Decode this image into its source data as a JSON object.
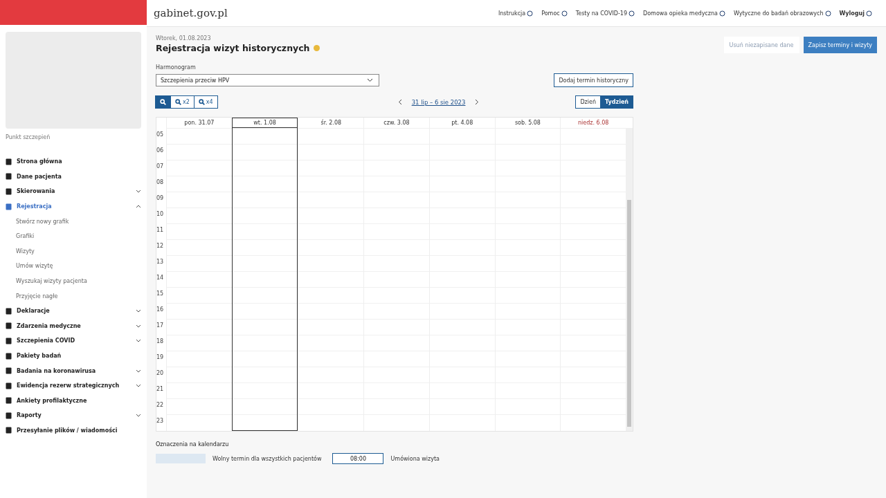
{
  "header": {
    "site_title": "gabinet.gov.pl",
    "links": [
      {
        "label": "Instrukcja",
        "bold": false
      },
      {
        "label": "Pomoc",
        "bold": false
      },
      {
        "label": "Testy na COVID-19",
        "bold": false
      },
      {
        "label": "Domowa opieka medyczna",
        "bold": false
      },
      {
        "label": "Wytyczne do badań obrazowych",
        "bold": false
      },
      {
        "label": "Wyloguj",
        "bold": true
      }
    ]
  },
  "sidebar": {
    "place_label": "Punkt szczepień",
    "items": [
      {
        "label": "Strona główna",
        "kind": "link",
        "selected": false
      },
      {
        "label": "Dane pacjenta",
        "kind": "link",
        "selected": false
      },
      {
        "label": "Skierowania",
        "kind": "group",
        "selected": false,
        "expanded": false
      },
      {
        "label": "Rejestracja",
        "kind": "group",
        "selected": true,
        "expanded": true,
        "children": [
          {
            "label": "Stwórz nowy grafik"
          },
          {
            "label": "Grafiki"
          },
          {
            "label": "Wizyty"
          },
          {
            "label": "Umów wizytę"
          },
          {
            "label": "Wyszukaj wizyty pacjenta"
          },
          {
            "label": "Przyjęcie nagłe"
          }
        ]
      },
      {
        "label": "Deklaracje",
        "kind": "group",
        "selected": false,
        "expanded": false
      },
      {
        "label": "Zdarzenia medyczne",
        "kind": "group",
        "selected": false,
        "expanded": false
      },
      {
        "label": "Szczepienia COVID",
        "kind": "group",
        "selected": false,
        "expanded": false
      },
      {
        "label": "Pakiety badań",
        "kind": "link",
        "selected": false
      },
      {
        "label": "Badania na koronawirusa",
        "kind": "group",
        "selected": false,
        "expanded": false
      },
      {
        "label": "Ewidencja rezerw strategicznych",
        "kind": "group",
        "selected": false,
        "expanded": false
      },
      {
        "label": "Ankiety profilaktyczne",
        "kind": "link",
        "selected": false
      },
      {
        "label": "Raporty",
        "kind": "group",
        "selected": false,
        "expanded": false
      },
      {
        "label": "Przesyłanie plików / wiadomości",
        "kind": "link",
        "selected": false
      }
    ]
  },
  "page": {
    "date": "Wtorek, 01.08.2023",
    "title": "Rejestracja wizyt historycznych",
    "actions": {
      "clear": "Usuń niezapisane dane",
      "save": "Zapisz terminy i wizyty"
    },
    "schedule": {
      "label": "Harmonogram",
      "value": "Szczepienia przeciw HPV"
    },
    "add_button": "Dodaj termin historyczny",
    "zoom": [
      {
        "selected": true
      },
      {
        "label": "x2",
        "selected": false
      },
      {
        "label": "x4",
        "selected": false
      }
    ],
    "range": "31 lip – 6 sie 2023",
    "views": [
      {
        "label": "Dzień",
        "selected": false
      },
      {
        "label": "Tydzień",
        "selected": true
      }
    ]
  },
  "calendar": {
    "days": [
      {
        "label": "pon. 31.07",
        "selected": false,
        "holiday": false
      },
      {
        "label": "wt. 1.08",
        "selected": true,
        "holiday": false
      },
      {
        "label": "śr. 2.08",
        "selected": false,
        "holiday": false
      },
      {
        "label": "czw. 3.08",
        "selected": false,
        "holiday": false
      },
      {
        "label": "pt. 4.08",
        "selected": false,
        "holiday": false
      },
      {
        "label": "sob. 5.08",
        "selected": false,
        "holiday": false
      },
      {
        "label": "niedz. 6.08",
        "selected": false,
        "holiday": true
      }
    ],
    "hours": [
      "05",
      "06",
      "07",
      "08",
      "09",
      "10",
      "11",
      "12",
      "13",
      "14",
      "15",
      "16",
      "17",
      "18",
      "19",
      "20",
      "21",
      "22",
      "23"
    ]
  },
  "legend": {
    "title": "Oznaczenia na kalendarzu",
    "items": [
      {
        "label": "Wolny termin dla wszystkich pacjentów"
      },
      {
        "label": "Umówiona wizyta",
        "sample": "08:00"
      }
    ]
  }
}
